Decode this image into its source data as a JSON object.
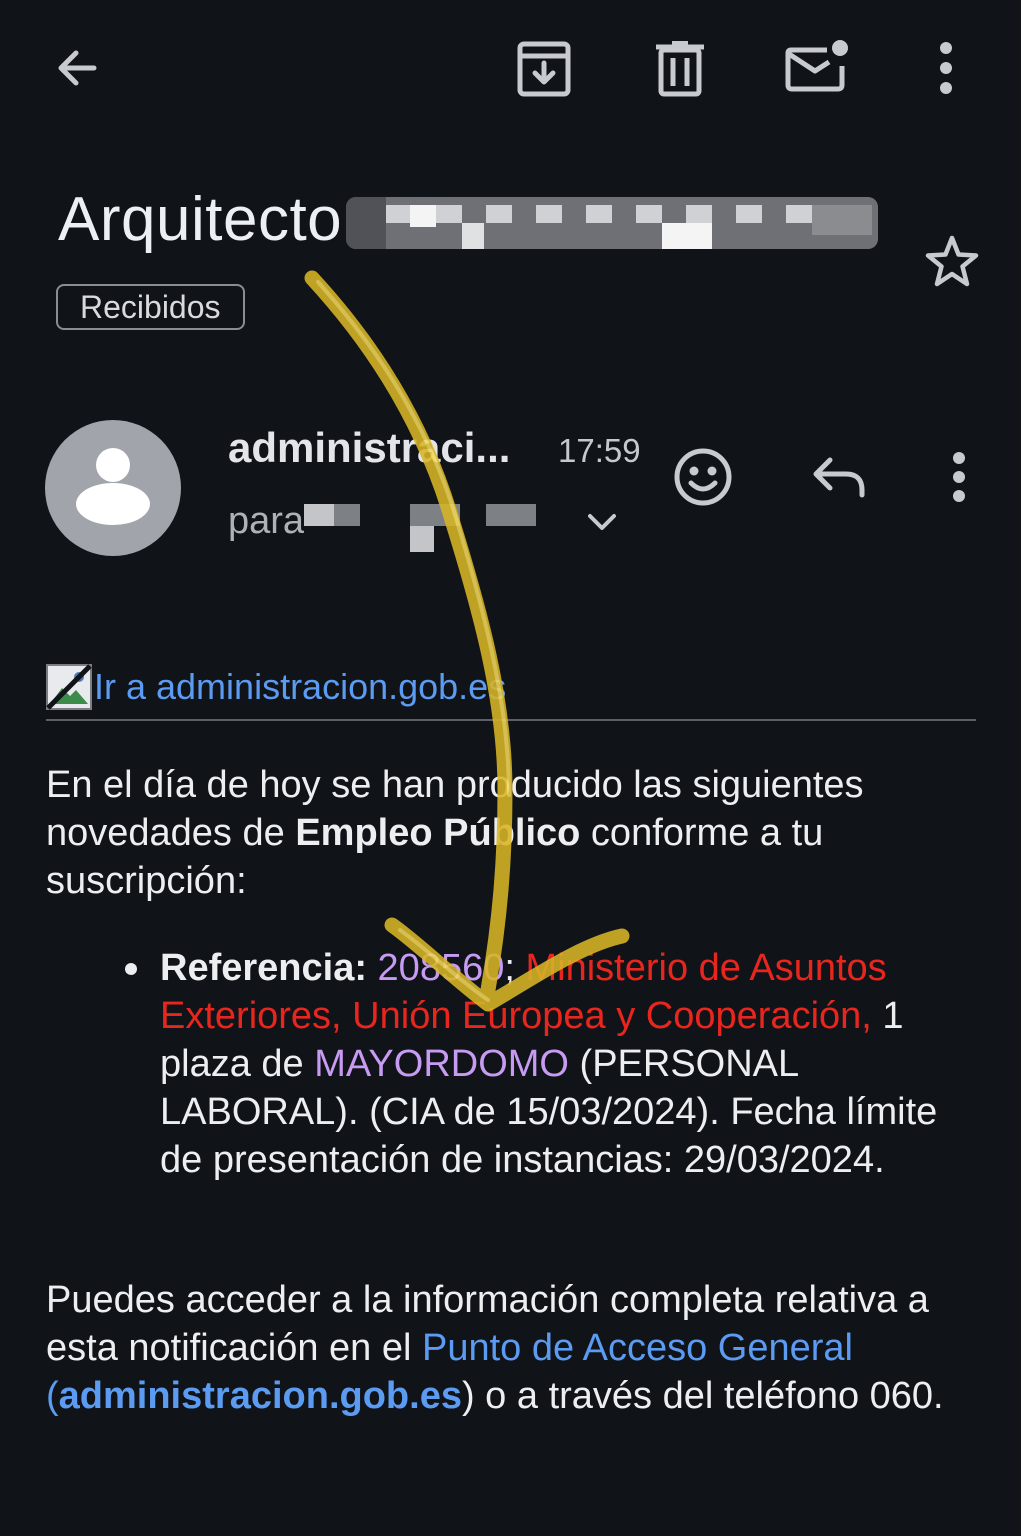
{
  "toolbar": {
    "back_icon": "arrow-left-icon",
    "archive_icon": "archive-icon",
    "delete_icon": "trash-icon",
    "mark_unread_icon": "mail-unread-icon",
    "more_icon": "more-vert-icon"
  },
  "email": {
    "subject": "Arquitecto",
    "label": "Recibidos",
    "star_icon": "star-outline-icon",
    "sender": "administraci...",
    "time": "17:59",
    "recipient_prefix": "para",
    "react_icon": "emoji-icon",
    "reply_icon": "reply-icon",
    "more_icon": "more-vert-icon"
  },
  "body": {
    "header_link": "Ir a administracion.gob.es",
    "intro_part1": "En el día de hoy se han producido las siguientes novedades de ",
    "intro_bold": "Empleo Público",
    "intro_part2": " conforme a tu suscripción:",
    "item": {
      "ref_label": "Referencia:",
      "ref_number": "208560",
      "sep": "; ",
      "ministry": "Ministerio de Asuntos Exteriores, Unión Europea y Cooperación,",
      "count_text": " 1 plaza de ",
      "job": "MAYORDOMO",
      "rest": " (PERSONAL LABORAL). (CIA de 15/03/2024). Fecha límite de presentación de instancias: 29/03/2024."
    },
    "footer_part1": "Puedes acceder a la información completa relativa a esta notificación en el ",
    "footer_link": "Punto de Acceso General",
    "footer_paren_open": " (",
    "footer_link2": "administracion.gob.es",
    "footer_part2": ") o a través del teléfono 060."
  },
  "colors": {
    "background": "#101318",
    "link": "#5b9bf1",
    "ministry": "#e8261e",
    "highlight": "#c79bf2",
    "annotation_arrow": "#d8b526"
  }
}
